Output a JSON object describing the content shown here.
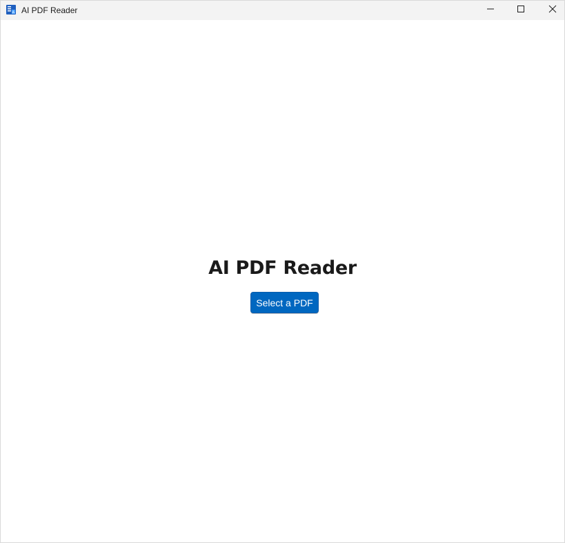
{
  "window": {
    "title": "AI PDF Reader",
    "app_icon": "pdf-reader-app-icon",
    "controls": {
      "minimize": "minimize-icon",
      "maximize": "maximize-icon",
      "close": "close-icon"
    }
  },
  "main": {
    "heading": "AI PDF Reader",
    "select_button_label": "Select a PDF"
  },
  "colors": {
    "accent": "#0067c0",
    "titlebar": "#f3f3f3",
    "background": "#ffffff",
    "text": "#1a1a1a"
  }
}
